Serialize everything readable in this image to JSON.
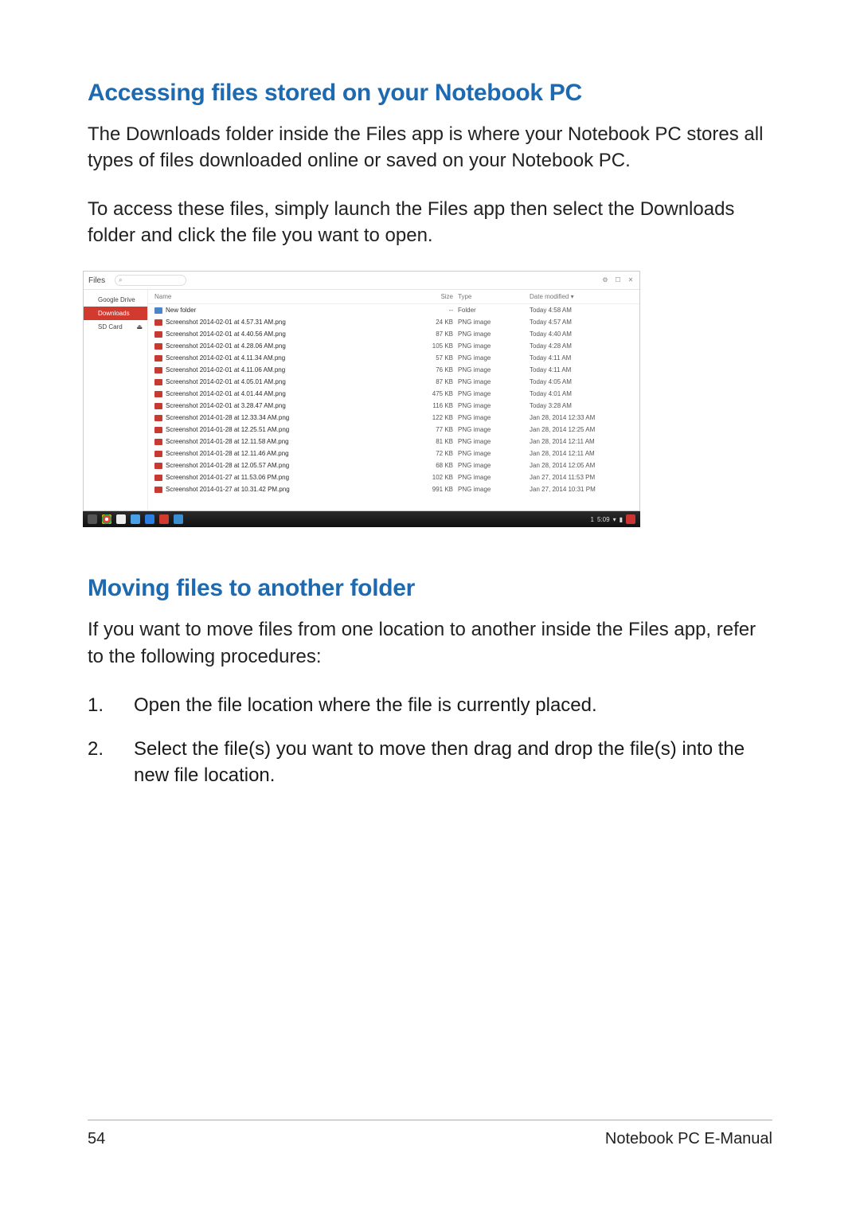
{
  "section1": {
    "heading": "Accessing files stored on your Notebook PC",
    "para1": "The Downloads folder inside the Files app is where your Notebook PC stores all types of files downloaded online or saved on your Notebook PC.",
    "para2": "To access these files, simply launch the Files app then select the Downloads folder and click the file you want to open."
  },
  "section2": {
    "heading": "Moving files to another folder",
    "para1": "If you want to move files from one location to another inside the Files app, refer to the following procedures:",
    "steps": {
      "n1": "1.",
      "t1": "Open the file location where the file is currently placed.",
      "n2": "2.",
      "t2": "Select the file(s) you want to move then drag and drop the file(s) into the new file location."
    }
  },
  "footer": {
    "page": "54",
    "label": "Notebook PC E-Manual"
  },
  "files": {
    "title": "Files",
    "search_icon": "⌕",
    "win_icons": {
      "gear": "⚙",
      "max": "☐",
      "close": "✕"
    },
    "sidebar": {
      "drive": "Google Drive",
      "downloads": "Downloads",
      "sdcard": "SD Card",
      "eject": "⏏"
    },
    "columns": {
      "name": "Name",
      "size": "Size",
      "type": "Type",
      "date": "Date modified ▾"
    },
    "rows": [
      {
        "folder": true,
        "name": "New folder",
        "size": "--",
        "type": "Folder",
        "date": "Today 4:58 AM"
      },
      {
        "folder": false,
        "name": "Screenshot 2014-02-01 at 4.57.31 AM.png",
        "size": "24 KB",
        "type": "PNG image",
        "date": "Today 4:57 AM"
      },
      {
        "folder": false,
        "name": "Screenshot 2014-02-01 at 4.40.56 AM.png",
        "size": "87 KB",
        "type": "PNG image",
        "date": "Today 4:40 AM"
      },
      {
        "folder": false,
        "name": "Screenshot 2014-02-01 at 4.28.06 AM.png",
        "size": "105 KB",
        "type": "PNG image",
        "date": "Today 4:28 AM"
      },
      {
        "folder": false,
        "name": "Screenshot 2014-02-01 at 4.11.34 AM.png",
        "size": "57 KB",
        "type": "PNG image",
        "date": "Today 4:11 AM"
      },
      {
        "folder": false,
        "name": "Screenshot 2014-02-01 at 4.11.06 AM.png",
        "size": "76 KB",
        "type": "PNG image",
        "date": "Today 4:11 AM"
      },
      {
        "folder": false,
        "name": "Screenshot 2014-02-01 at 4.05.01 AM.png",
        "size": "87 KB",
        "type": "PNG image",
        "date": "Today 4:05 AM"
      },
      {
        "folder": false,
        "name": "Screenshot 2014-02-01 at 4.01.44 AM.png",
        "size": "475 KB",
        "type": "PNG image",
        "date": "Today 4:01 AM"
      },
      {
        "folder": false,
        "name": "Screenshot 2014-02-01 at 3.28.47 AM.png",
        "size": "116 KB",
        "type": "PNG image",
        "date": "Today 3:28 AM"
      },
      {
        "folder": false,
        "name": "Screenshot 2014-01-28 at 12.33.34 AM.png",
        "size": "122 KB",
        "type": "PNG image",
        "date": "Jan 28, 2014 12:33 AM"
      },
      {
        "folder": false,
        "name": "Screenshot 2014-01-28 at 12.25.51 AM.png",
        "size": "77 KB",
        "type": "PNG image",
        "date": "Jan 28, 2014 12:25 AM"
      },
      {
        "folder": false,
        "name": "Screenshot 2014-01-28 at 12.11.58 AM.png",
        "size": "81 KB",
        "type": "PNG image",
        "date": "Jan 28, 2014 12:11 AM"
      },
      {
        "folder": false,
        "name": "Screenshot 2014-01-28 at 12.11.46 AM.png",
        "size": "72 KB",
        "type": "PNG image",
        "date": "Jan 28, 2014 12:11 AM"
      },
      {
        "folder": false,
        "name": "Screenshot 2014-01-28 at 12.05.57 AM.png",
        "size": "68 KB",
        "type": "PNG image",
        "date": "Jan 28, 2014 12:05 AM"
      },
      {
        "folder": false,
        "name": "Screenshot 2014-01-27 at 11.53.06 PM.png",
        "size": "102 KB",
        "type": "PNG image",
        "date": "Jan 27, 2014 11:53 PM"
      },
      {
        "folder": false,
        "name": "Screenshot 2014-01-27 at 10.31.42 PM.png",
        "size": "991 KB",
        "type": "PNG image",
        "date": "Jan 27, 2014 10:31 PM"
      }
    ],
    "taskbar": {
      "notif": "1",
      "time": "5:09",
      "wifi": "▾",
      "batt": "▮"
    }
  }
}
